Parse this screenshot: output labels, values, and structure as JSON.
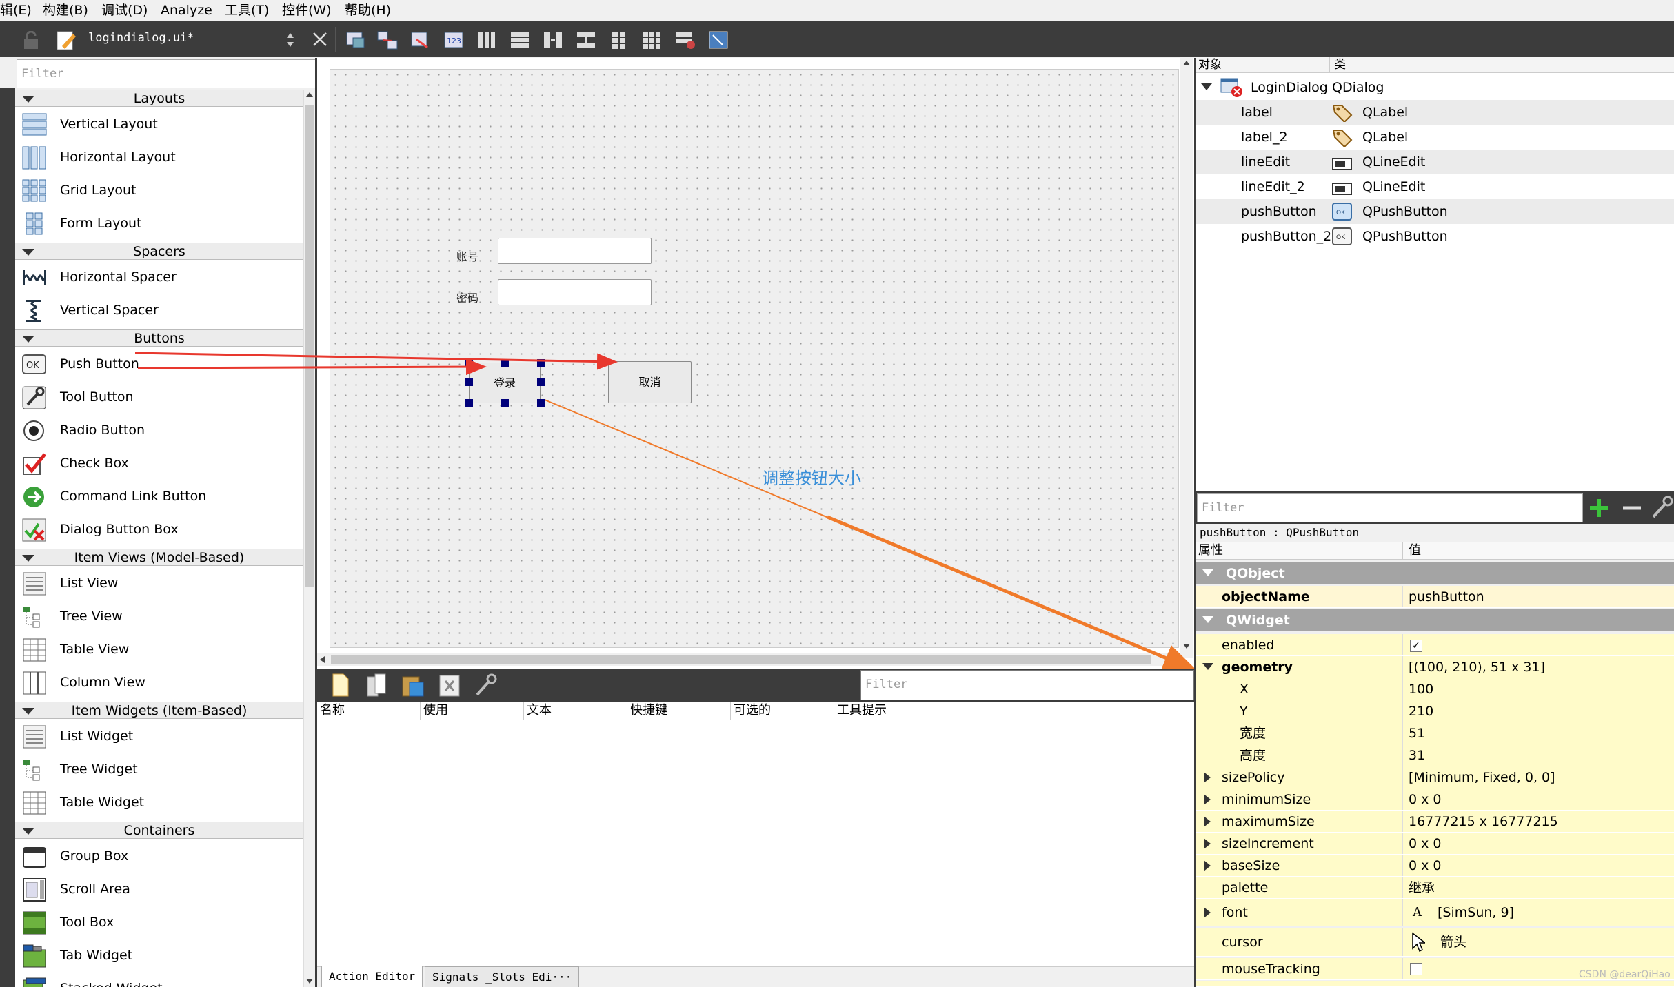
{
  "menubar": {
    "items": [
      "辑(E)",
      "构建(B)",
      "调试(D)",
      "Analyze",
      "工具(T)",
      "控件(W)",
      "帮助(H)"
    ]
  },
  "toolbar": {
    "filename": "logindialog.ui*"
  },
  "widget_box": {
    "filter_placeholder": "Filter",
    "categories": [
      {
        "name": "Layouts",
        "items": [
          "Vertical Layout",
          "Horizontal Layout",
          "Grid Layout",
          "Form Layout"
        ]
      },
      {
        "name": "Spacers",
        "items": [
          "Horizontal Spacer",
          "Vertical Spacer"
        ]
      },
      {
        "name": "Buttons",
        "items": [
          "Push Button",
          "Tool Button",
          "Radio Button",
          "Check Box",
          "Command Link Button",
          "Dialog Button Box"
        ]
      },
      {
        "name": "Item Views (Model-Based)",
        "items": [
          "List View",
          "Tree View",
          "Table View",
          "Column View"
        ]
      },
      {
        "name": "Item Widgets (Item-Based)",
        "items": [
          "List Widget",
          "Tree Widget",
          "Table Widget"
        ]
      },
      {
        "name": "Containers",
        "items": [
          "Group Box",
          "Scroll Area",
          "Tool Box",
          "Tab Widget",
          "Stacked Widget"
        ]
      }
    ]
  },
  "form": {
    "label_account": "账号",
    "label_password": "密码",
    "login_button": "登录",
    "cancel_button": "取消",
    "annotation": "调整按钮大小",
    "annotation_color": "#3a8fd8",
    "arrow_red": "#e8382e",
    "arrow_orange": "#f07a2a"
  },
  "action_editor": {
    "filter_placeholder": "Filter",
    "columns": [
      "名称",
      "使用",
      "文本",
      "快捷键",
      "可选的",
      "工具提示"
    ],
    "tabs": [
      "Action Editor",
      "Signals _Slots Edi···"
    ]
  },
  "object_inspector": {
    "headers": {
      "object": "对象",
      "class": "类"
    },
    "rows": [
      {
        "object": "LoginDialog",
        "class": "QDialog",
        "icon": "dialog-icon"
      },
      {
        "object": "label",
        "class": "QLabel",
        "icon": "label-icon"
      },
      {
        "object": "label_2",
        "class": "QLabel",
        "icon": "label-icon"
      },
      {
        "object": "lineEdit",
        "class": "QLineEdit",
        "icon": "lineedit-icon"
      },
      {
        "object": "lineEdit_2",
        "class": "QLineEdit",
        "icon": "lineedit-icon"
      },
      {
        "object": "pushButton",
        "class": "QPushButton",
        "icon": "pushbutton-icon"
      },
      {
        "object": "pushButton_2",
        "class": "QPushButton",
        "icon": "pushbutton-icon"
      }
    ]
  },
  "property_editor": {
    "filter_placeholder": "Filter",
    "subject": "pushButton : QPushButton",
    "headers": {
      "property": "属性",
      "value": "值"
    },
    "group_qobject": "QObject",
    "group_qwidget": "QWidget",
    "props": {
      "objectName": {
        "name": "objectName",
        "value": "pushButton"
      },
      "enabled": {
        "name": "enabled",
        "value": "✓"
      },
      "geometry": {
        "name": "geometry",
        "value": "[(100, 210), 51 x 31]"
      },
      "x": {
        "name": "X",
        "value": "100"
      },
      "y": {
        "name": "Y",
        "value": "210"
      },
      "width": {
        "name": "宽度",
        "value": "51"
      },
      "height": {
        "name": "高度",
        "value": "31"
      },
      "sizePolicy": {
        "name": "sizePolicy",
        "value": "[Minimum, Fixed, 0, 0]"
      },
      "minimumSize": {
        "name": "minimumSize",
        "value": "0 x 0"
      },
      "maximumSize": {
        "name": "maximumSize",
        "value": "16777215 x 16777215"
      },
      "sizeIncrement": {
        "name": "sizeIncrement",
        "value": "0 x 0"
      },
      "baseSize": {
        "name": "baseSize",
        "value": "0 x 0"
      },
      "palette": {
        "name": "palette",
        "value": "继承"
      },
      "font": {
        "name": "font",
        "value": "[SimSun, 9]"
      },
      "cursor": {
        "name": "cursor",
        "value": "箭头"
      },
      "mouseTracking": {
        "name": "mouseTracking",
        "value": ""
      }
    }
  },
  "watermark": "CSDN @dearQiHao"
}
